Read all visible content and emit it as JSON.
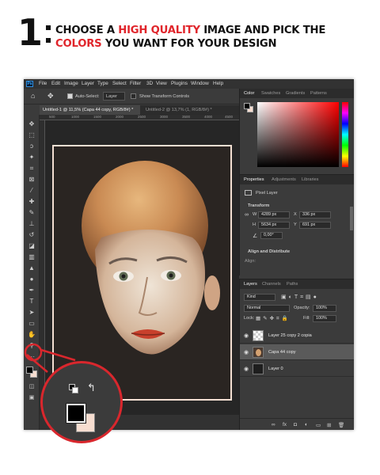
{
  "heading": {
    "step_number": "1",
    "line1_part1": "CHOOSE A ",
    "line1_highlight": "HIGH QUALITY",
    "line1_part2": " IMAGE AND PICK THE",
    "line2_highlight": "COLORS",
    "line2_part2": " YOU WANT FOR YOUR DESIGN",
    "highlight_color": "#e0252b"
  },
  "app": {
    "logo": "Ps",
    "menu": [
      "File",
      "Edit",
      "Image",
      "Layer",
      "Type",
      "Select",
      "Filter",
      "3D",
      "View",
      "Plugins",
      "Window",
      "Help"
    ]
  },
  "options_bar": {
    "auto_select_label": "Auto-Select:",
    "auto_select_value": "Layer",
    "show_transform_label": "Show Transform Controls"
  },
  "doc_tabs": [
    {
      "label": "Untitled-1 @ 11,5% (Capa 44 copy, RGB/8#) *"
    },
    {
      "label": "Untitled-2 @ 13,7% (1, RGB/8#) *"
    }
  ],
  "ruler_marks": [
    "500",
    "1000",
    "1500",
    "2000",
    "2500",
    "3000",
    "3500",
    "4000",
    "4500"
  ],
  "color_panel": {
    "tabs": [
      "Color",
      "Swatches",
      "Gradients",
      "Patterns"
    ],
    "foreground": "#000000",
    "background": "#f6ddd0",
    "hue_color": "#ff0000"
  },
  "properties_panel": {
    "tabs": [
      "Properties",
      "Adjustments",
      "Libraries"
    ],
    "layer_type": "Pixel Layer",
    "transform_title": "Transform",
    "w_label": "W",
    "w_value": "4289 px",
    "x_label": "X",
    "x_value": "336 px",
    "h_label": "H",
    "h_value": "5634 px",
    "y_label": "Y",
    "y_value": "691 px",
    "angle_value": "0,00°",
    "align_title": "Align and Distribute",
    "align_label": "Align:"
  },
  "layers_panel": {
    "tabs": [
      "Layers",
      "Channels",
      "Paths"
    ],
    "kind_label": "Kind",
    "blend_mode": "Normal",
    "opacity_label": "Opacity:",
    "opacity_value": "100%",
    "lock_label": "Lock:",
    "fill_label": "Fill:",
    "fill_value": "100%",
    "layers": [
      {
        "name": "Layer 25 copy 2 copia",
        "selected": false
      },
      {
        "name": "Capa 44 copy",
        "selected": true
      },
      {
        "name": "Layer 0",
        "selected": false
      }
    ]
  },
  "zoom_callout": {
    "foreground": "#000000",
    "background": "#f6ddd0",
    "border_color": "#d9272d"
  }
}
